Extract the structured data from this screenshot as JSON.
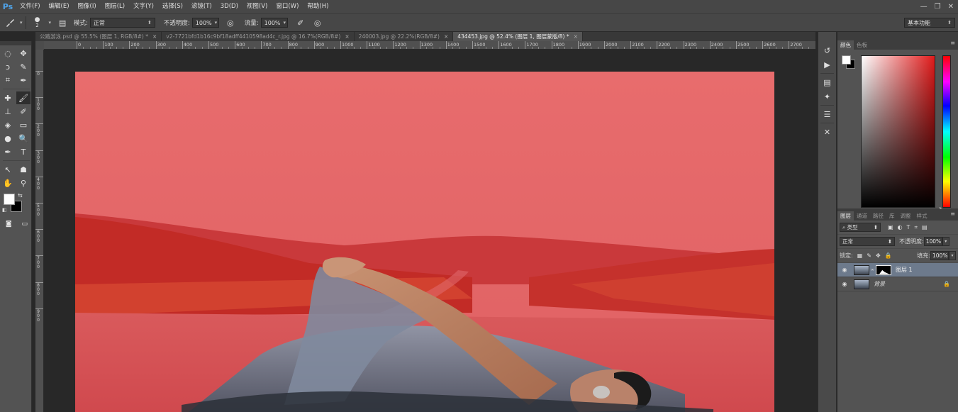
{
  "app": {
    "logo": "Ps"
  },
  "menu": [
    "文件(F)",
    "编辑(E)",
    "图像(I)",
    "图层(L)",
    "文字(Y)",
    "选择(S)",
    "滤镜(T)",
    "3D(D)",
    "视图(V)",
    "窗口(W)",
    "帮助(H)"
  ],
  "window_controls": {
    "minimize": "—",
    "restore": "❐",
    "close": "✕"
  },
  "options_bar": {
    "brush_size": "2",
    "mode_label": "模式:",
    "mode_value": "正常",
    "opacity_label": "不透明度:",
    "opacity_value": "100%",
    "flow_label": "流量:",
    "flow_value": "100%",
    "workspace": "基本功能"
  },
  "tabs": [
    {
      "title": "公路游泳.psd @ 55.5% (图层 1, RGB/8#) *",
      "active": false
    },
    {
      "title": "v2-7721bfd1b16c9bf18adff4410598ad4c_r.jpg @ 16.7%(RGB/8#)",
      "active": false
    },
    {
      "title": "240003.jpg @ 22.2%(RGB/8#)",
      "active": false
    },
    {
      "title": "434453.jpg @ 52.4% (图层 1, 图层蒙版/8) *",
      "active": true
    }
  ],
  "tab_close": "×",
  "ruler_h": [
    "0",
    "100",
    "200",
    "300",
    "400",
    "500",
    "600",
    "700",
    "800",
    "900",
    "1000",
    "1100",
    "1200",
    "1300",
    "1400",
    "1500",
    "1600",
    "1700",
    "1800",
    "1900",
    "2000",
    "2100",
    "2200",
    "2300",
    "2400",
    "2500",
    "2600",
    "2700"
  ],
  "ruler_v": [
    "0",
    "1 0 0",
    "2 0 0",
    "3 0 0",
    "4 0 0",
    "5 0 0",
    "6 0 0",
    "7 0 0",
    "8 0 0",
    "9 0 0"
  ],
  "tools": [
    "marquee-icon",
    "move-icon",
    "lasso-icon",
    "quick-select-icon",
    "crop-icon",
    "eyedropper-icon",
    "healing-icon",
    "brush-icon",
    "stamp-icon",
    "history-brush-icon",
    "eraser-icon",
    "gradient-icon",
    "blur-icon",
    "dodge-icon",
    "pen-icon",
    "type-icon",
    "path-select-icon",
    "shape-icon",
    "hand-icon",
    "zoom-icon"
  ],
  "tool_glyphs": [
    "◌",
    "✥",
    "ↄ",
    "✎",
    "⌗",
    "✒",
    "✚",
    "🖌",
    "⊥",
    "✐",
    "◈",
    "▭",
    "●",
    "🔍",
    "✒",
    "T",
    "↖",
    "☗",
    "✋",
    "⚲"
  ],
  "color_panel": {
    "tabs": [
      "颜色",
      "色板"
    ]
  },
  "layers_panel": {
    "tabs": [
      "图层",
      "通道",
      "路径",
      "库",
      "调整",
      "样式"
    ],
    "filter_label": "类型",
    "filter_icons": [
      "▣",
      "◐",
      "T",
      "⌗",
      "▤"
    ],
    "blend_mode": "正常",
    "opacity_label": "不透明度:",
    "opacity_value": "100%",
    "lock_label": "锁定:",
    "lock_icons": [
      "▦",
      "✎",
      "✥",
      "🔒"
    ],
    "fill_label": "填充:",
    "fill_value": "100%",
    "layers": [
      {
        "name": "图层 1",
        "selected": true,
        "has_mask": true,
        "locked": false
      },
      {
        "name": "背景",
        "selected": false,
        "has_mask": false,
        "locked": true
      }
    ]
  },
  "mini_panel_icons": [
    "history-icon",
    "play-icon",
    "brush-preset-icon",
    "clone-source-icon",
    "adjust-icon",
    "tool-preset-icon"
  ],
  "mini_panel_glyphs": [
    "↺",
    "▶",
    "▤",
    "✦",
    "☰",
    "✕"
  ],
  "colors": {
    "overlay_red": "#e86a6c",
    "selected_layer": "#6d7a8c"
  }
}
